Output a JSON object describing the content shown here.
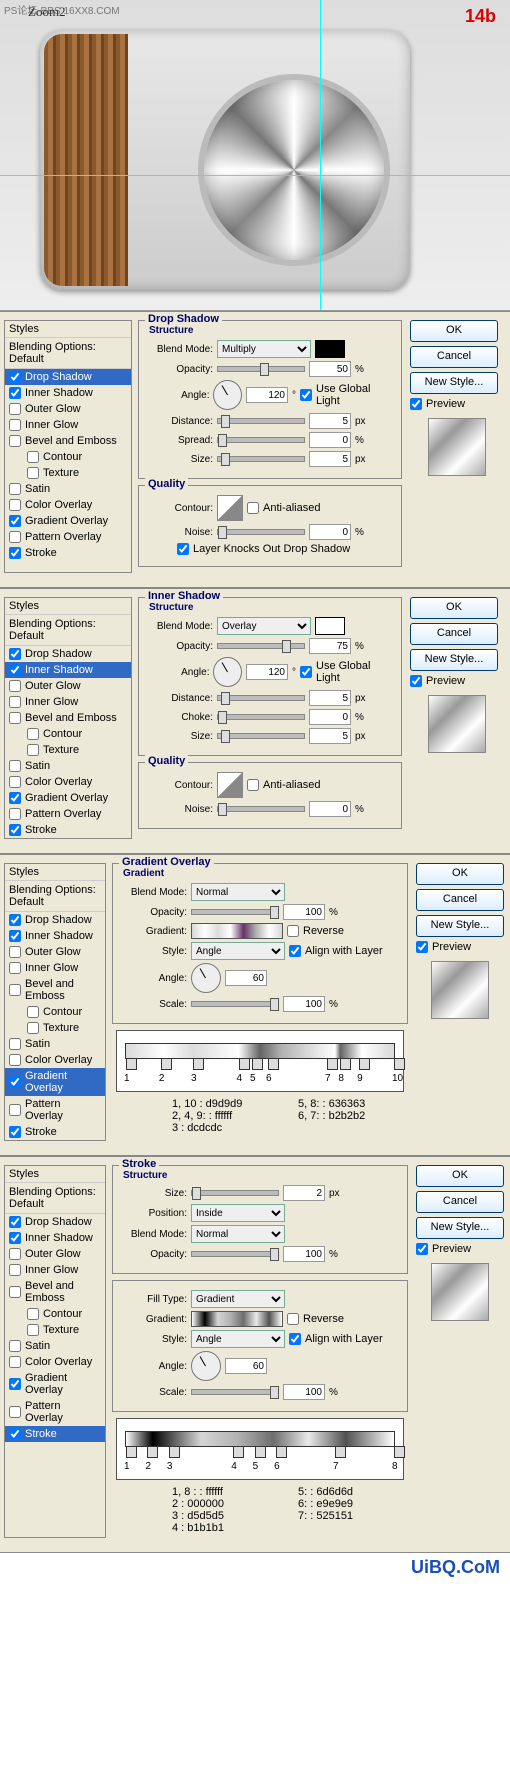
{
  "preview": {
    "zoom_label": "Zoom2",
    "url": "PS论坛-BBS.16XX8.COM",
    "step": "14b"
  },
  "common": {
    "styles_header": "Styles",
    "blending_default": "Blending Options: Default",
    "styles": [
      "Drop Shadow",
      "Inner Shadow",
      "Outer Glow",
      "Inner Glow",
      "Bevel and Emboss",
      "Contour",
      "Texture",
      "Satin",
      "Color Overlay",
      "Gradient Overlay",
      "Pattern Overlay",
      "Stroke"
    ],
    "ok": "OK",
    "cancel": "Cancel",
    "new_style": "New Style...",
    "preview": "Preview",
    "blend_mode": "Blend Mode:",
    "opacity": "Opacity:",
    "angle": "Angle:",
    "distance": "Distance:",
    "size": "Size:",
    "spread": "Spread:",
    "choke": "Choke:",
    "noise": "Noise:",
    "contour": "Contour:",
    "anti_aliased": "Anti-aliased",
    "pct": "%",
    "px": "px",
    "deg": "°",
    "use_global": "Use Global Light",
    "gradient": "Gradient:",
    "reverse": "Reverse",
    "style": "Style:",
    "align": "Align with Layer",
    "scale": "Scale:",
    "position": "Position:",
    "fill_type": "Fill Type:"
  },
  "panels": [
    {
      "title": "Drop Shadow",
      "sub": "Structure",
      "checked": [
        "Drop Shadow",
        "Inner Shadow",
        "Gradient Overlay",
        "Stroke"
      ],
      "selected": "Drop Shadow",
      "mode": "Multiply",
      "swatch": "black",
      "opacity": "50",
      "angle": "120",
      "distance": "5",
      "spread": "0",
      "size": "5",
      "quality_title": "Quality",
      "noise": "0",
      "knock": "Layer Knocks Out Drop Shadow"
    },
    {
      "title": "Inner Shadow",
      "sub": "Structure",
      "checked": [
        "Drop Shadow",
        "Inner Shadow",
        "Gradient Overlay",
        "Stroke"
      ],
      "selected": "Inner Shadow",
      "mode": "Overlay",
      "swatch": "white",
      "opacity": "75",
      "angle": "120",
      "distance": "5",
      "choke": "0",
      "size": "5",
      "quality_title": "Quality",
      "noise": "0"
    },
    {
      "title": "Gradient Overlay",
      "sub": "Gradient",
      "checked": [
        "Drop Shadow",
        "Inner Shadow",
        "Gradient Overlay",
        "Stroke"
      ],
      "selected": "Gradient Overlay",
      "mode": "Normal",
      "opacity": "100",
      "style_val": "Angle",
      "angle": "60",
      "scale": "100",
      "align_checked": true,
      "stops": [
        0,
        13,
        25,
        42,
        47,
        53,
        75,
        80,
        87,
        100
      ],
      "stop_labels": [
        "1",
        "2",
        "3",
        "4",
        "5",
        "6",
        "7",
        "8",
        "9",
        "10"
      ],
      "legend": [
        [
          "1, 10",
          "d9d9d9"
        ],
        [
          "5, 8:",
          "636363"
        ],
        [
          "2, 4, 9:",
          "ffffff"
        ],
        [
          "6, 7:",
          "b2b2b2"
        ],
        [
          "3",
          "dcdcdc"
        ]
      ]
    },
    {
      "title": "Stroke",
      "sub": "Structure",
      "checked": [
        "Drop Shadow",
        "Inner Shadow",
        "Gradient Overlay",
        "Stroke"
      ],
      "selected": "Stroke",
      "size": "2",
      "position": "Inside",
      "mode": "Normal",
      "opacity": "100",
      "fill_type": "Gradient",
      "style_val": "Angle",
      "angle": "60",
      "scale": "100",
      "align_checked": true,
      "stops": [
        0,
        8,
        16,
        40,
        48,
        56,
        78,
        100
      ],
      "stop_labels": [
        "1",
        "2",
        "3",
        "4",
        "5",
        "6",
        "7",
        "8"
      ],
      "legend": [
        [
          "1, 8 :",
          "ffffff"
        ],
        [
          "5:",
          "6d6d6d"
        ],
        [
          "2",
          "000000"
        ],
        [
          "6:",
          "e9e9e9"
        ],
        [
          "3",
          "d5d5d5"
        ],
        [
          "7:",
          "525151"
        ],
        [
          "4",
          "b1b1b1"
        ]
      ]
    }
  ],
  "watermark": "UiBQ.CoM"
}
